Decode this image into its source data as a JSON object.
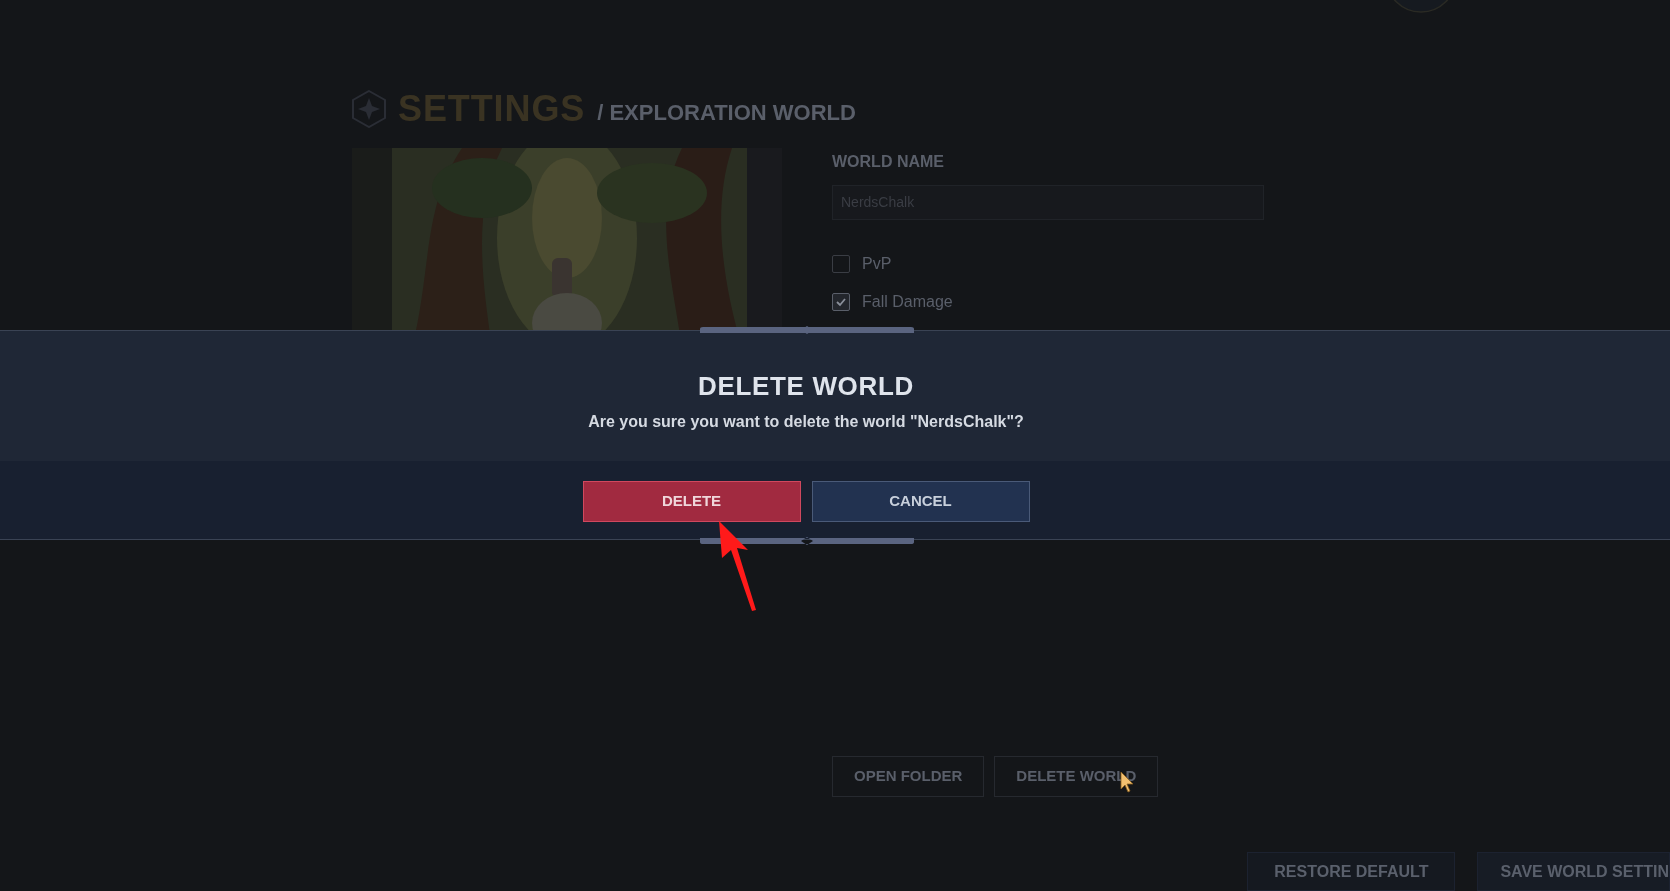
{
  "header": {
    "title": "SETTINGS",
    "subtitle": "/ EXPLORATION WORLD"
  },
  "world_name": {
    "label": "WORLD NAME",
    "value": "NerdsChalk"
  },
  "options": [
    {
      "label": "PvP",
      "checked": false
    },
    {
      "label": "Fall Damage",
      "checked": true
    }
  ],
  "world_buttons": [
    "OPEN FOLDER",
    "DELETE WORLD"
  ],
  "footer_buttons": [
    "RESTORE DEFAULT",
    "SAVE WORLD SETTIN"
  ],
  "dialog": {
    "title": "DELETE WORLD",
    "message": "Are you sure you want to delete the world \"NerdsChalk\"?",
    "buttons": [
      {
        "label": "DELETE",
        "kind": "danger"
      },
      {
        "label": "CANCEL",
        "kind": "secondary"
      }
    ]
  }
}
